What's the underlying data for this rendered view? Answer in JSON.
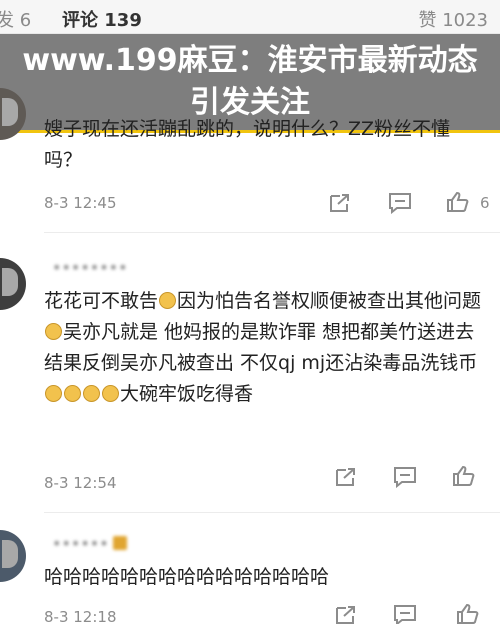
{
  "tabs": {
    "forward": "发 6",
    "comments": "评论 139",
    "likes": "赞 1023"
  },
  "banner": {
    "headline": "www.199麻豆：淮安市最新动态引发关注"
  },
  "comments": [
    {
      "text": "嫂子现在还活蹦乱跳的，说明什么？ZZ粉丝不懂吗？",
      "time": "8-3 12:45",
      "likes": "6"
    },
    {
      "username": "••••••••",
      "text_parts": [
        "花花可不敢告",
        "因为怕告名誉权顺便被查出其他问题",
        "吴亦凡就是 他妈报的是欺诈罪 想把都美竹送进去 结果反倒吴亦凡被查出 不仅qj mj还沾染毒品洗钱币",
        "大碗牢饭吃得香"
      ],
      "time": "8-3 12:54"
    },
    {
      "username": "••••••",
      "text": "哈哈哈哈哈哈哈哈哈哈哈哈哈哈哈",
      "time": "8-3 12:18"
    }
  ],
  "icons": {
    "share": "share-icon",
    "reply": "comment-icon",
    "like": "thumbs-up-icon"
  },
  "colors": {
    "banner_rule": "#f1c40f",
    "muted": "#8c8c8c"
  }
}
